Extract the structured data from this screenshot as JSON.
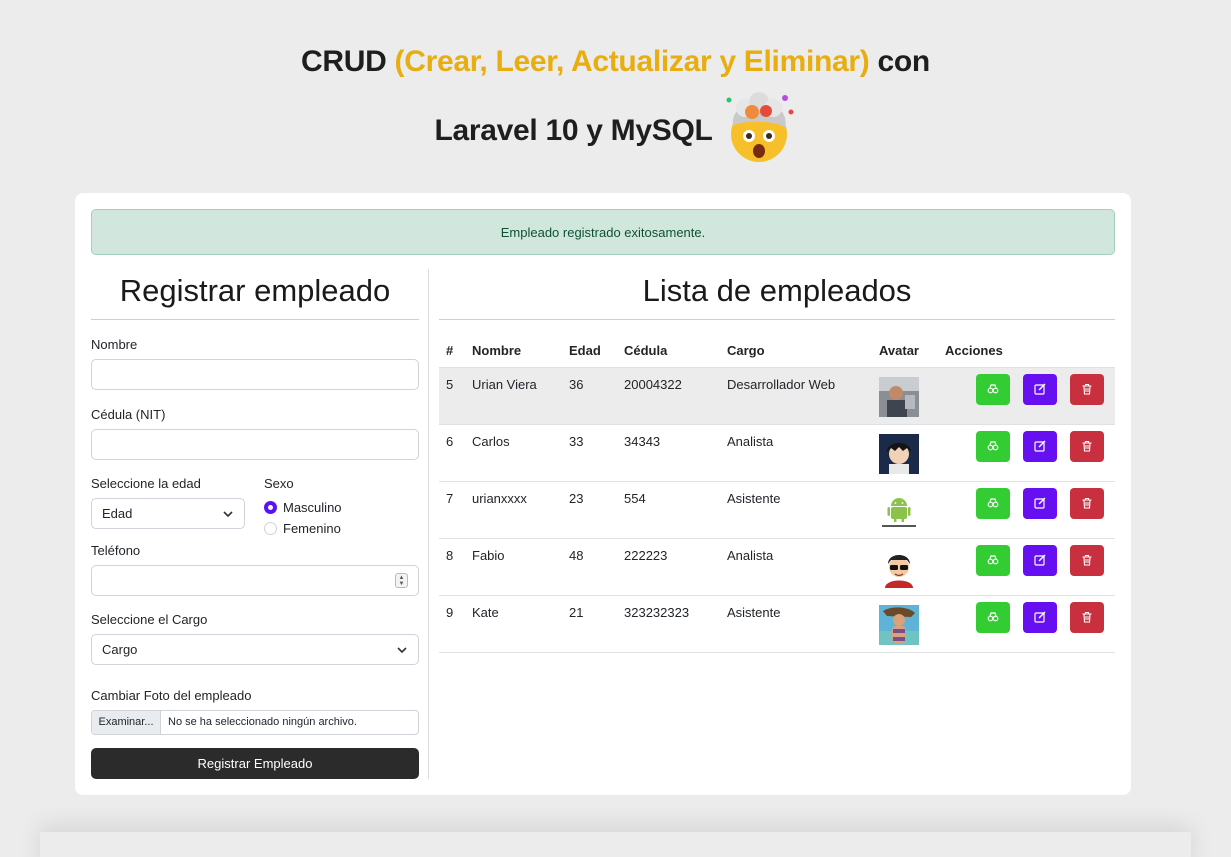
{
  "header": {
    "title_part1": "CRUD ",
    "title_highlight": "(Crear, Leer, Actualizar y Eliminar)",
    "title_part2": " con",
    "title_line2": "Laravel 10 y MySQL",
    "emoji_icon": "exploding-head-emoji"
  },
  "alert": {
    "message": "Empleado registrado exitosamente."
  },
  "form": {
    "title": "Registrar empleado",
    "nombre_label": "Nombre",
    "nombre_value": "",
    "cedula_label": "Cédula (NIT)",
    "cedula_value": "",
    "edad_label": "Seleccione la edad",
    "edad_selected": "Edad",
    "sexo_label": "Sexo",
    "sexo_options": [
      "Masculino",
      "Femenino"
    ],
    "sexo_selected": "Masculino",
    "telefono_label": "Teléfono",
    "telefono_value": "",
    "cargo_label": "Seleccione el Cargo",
    "cargo_selected": "Cargo",
    "foto_label": "Cambiar Foto del empleado",
    "foto_button": "Examinar...",
    "foto_filename": "No se ha seleccionado ningún archivo.",
    "submit_label": "Registrar Empleado"
  },
  "list": {
    "title": "Lista de empleados",
    "columns": [
      "#",
      "Nombre",
      "Edad",
      "Cédula",
      "Cargo",
      "Avatar",
      "Acciones"
    ],
    "rows": [
      {
        "id": "5",
        "nombre": "Urian Viera",
        "edad": "36",
        "cedula": "20004322",
        "cargo": "Desarrollador Web",
        "avatar": "photo-man"
      },
      {
        "id": "6",
        "nombre": "Carlos",
        "edad": "33",
        "cedula": "34343",
        "cargo": "Analista",
        "avatar": "anime-boy"
      },
      {
        "id": "7",
        "nombre": "urianxxxx",
        "edad": "23",
        "cedula": "554",
        "cargo": "Asistente",
        "avatar": "android-logo"
      },
      {
        "id": "8",
        "nombre": "Fabio",
        "edad": "48",
        "cedula": "222223",
        "cargo": "Analista",
        "avatar": "cartoon-sunglasses"
      },
      {
        "id": "9",
        "nombre": "Kate",
        "edad": "21",
        "cedula": "323232323",
        "cargo": "Asistente",
        "avatar": "photo-beach"
      }
    ],
    "action_icons": [
      "view-icon",
      "edit-icon",
      "delete-icon"
    ]
  },
  "colors": {
    "highlight": "#e8ad0e",
    "alert_bg": "#d1e7dd",
    "view_btn": "#33cc33",
    "edit_btn": "#6610f2",
    "delete_btn": "#c9303f",
    "submit_btn": "#2b2b2b"
  }
}
